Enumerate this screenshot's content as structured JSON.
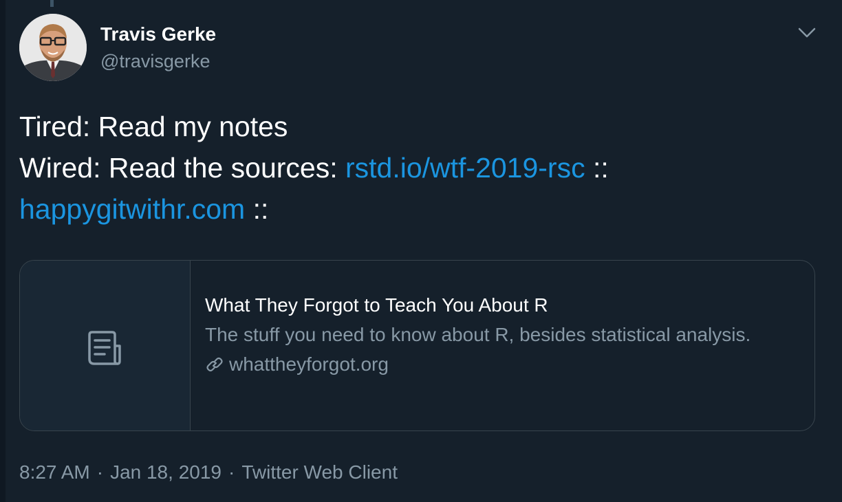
{
  "author": {
    "name": "Travis Gerke",
    "handle": "@travisgerke"
  },
  "tweet": {
    "line1": "Tired: Read my notes",
    "line2_prefix": "Wired: Read the sources: ",
    "link1": "rstd.io/wtf-2019-rsc",
    "sep1": " ::",
    "link2": "happygitwithr.com",
    "sep2": " ::"
  },
  "card": {
    "icon": "document-icon",
    "title": "What They Forgot to Teach You About R",
    "description": "The stuff you need to know about R, besides statistical analysis.",
    "domain_icon": "link-icon",
    "domain": "whattheyforgot.org"
  },
  "meta": {
    "time": "8:27 AM",
    "separator": "·",
    "date": "Jan 18, 2019",
    "client": "Twitter Web Client"
  },
  "colors": {
    "background": "#15202b",
    "link": "#1b95e0",
    "secondary_text": "#8899a6",
    "border": "#38444d"
  }
}
